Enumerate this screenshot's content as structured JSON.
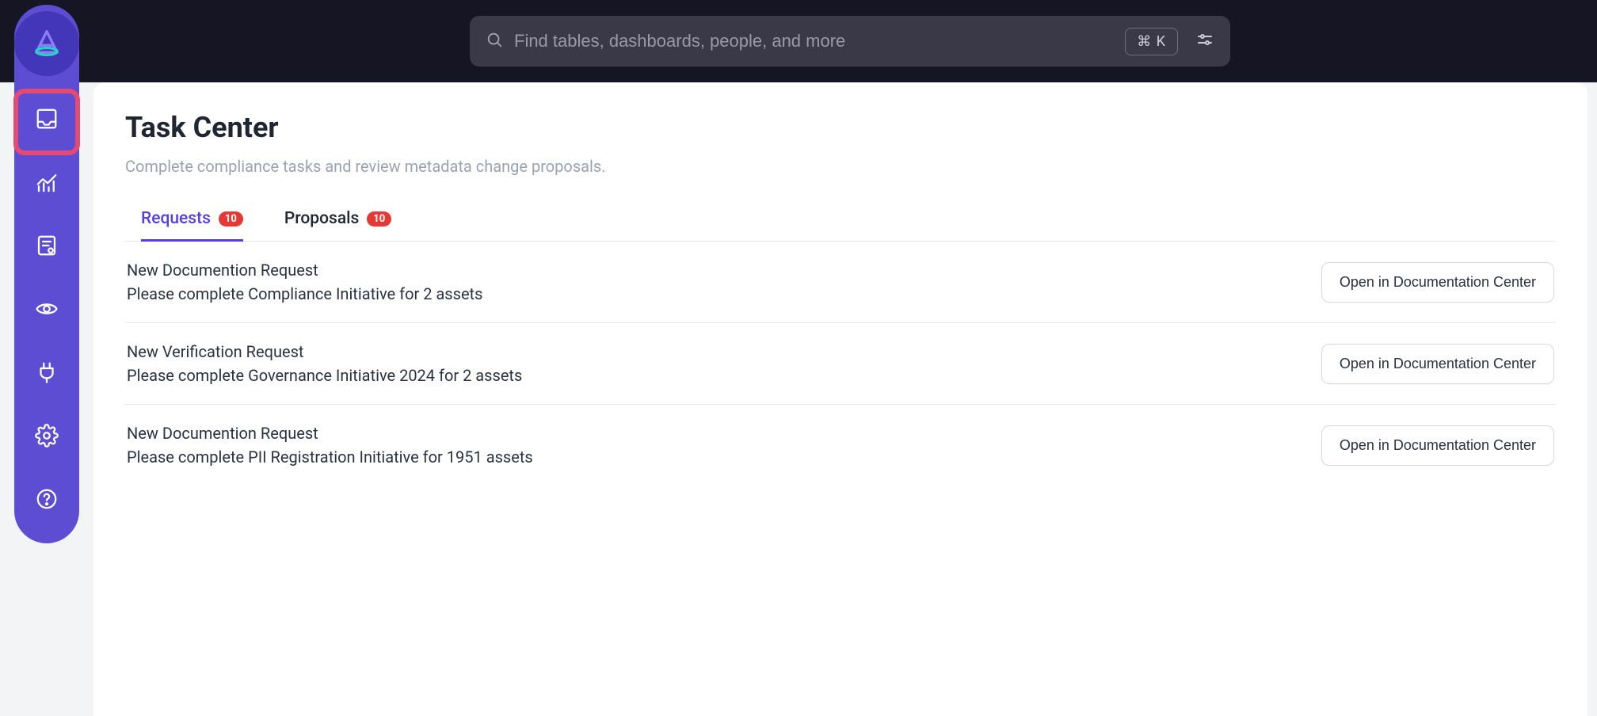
{
  "search": {
    "placeholder": "Find tables, dashboards, people, and more",
    "shortcut": "⌘ K"
  },
  "page": {
    "title": "Task Center",
    "subtitle": "Complete compliance tasks and review metadata change proposals."
  },
  "tabs": [
    {
      "label": "Requests",
      "count": "10",
      "active": true
    },
    {
      "label": "Proposals",
      "count": "10",
      "active": false
    }
  ],
  "tasks": [
    {
      "title": "New Documention Request",
      "desc": "Please complete Compliance Initiative for 2 assets",
      "action": "Open in Documentation Center"
    },
    {
      "title": "New Verification Request",
      "desc": "Please complete Governance Initiative 2024 for 2 assets",
      "action": "Open in Documentation Center"
    },
    {
      "title": "New Documention Request",
      "desc": "Please complete PII Registration Initiative for 1951 assets",
      "action": "Open in Documentation Center"
    }
  ]
}
